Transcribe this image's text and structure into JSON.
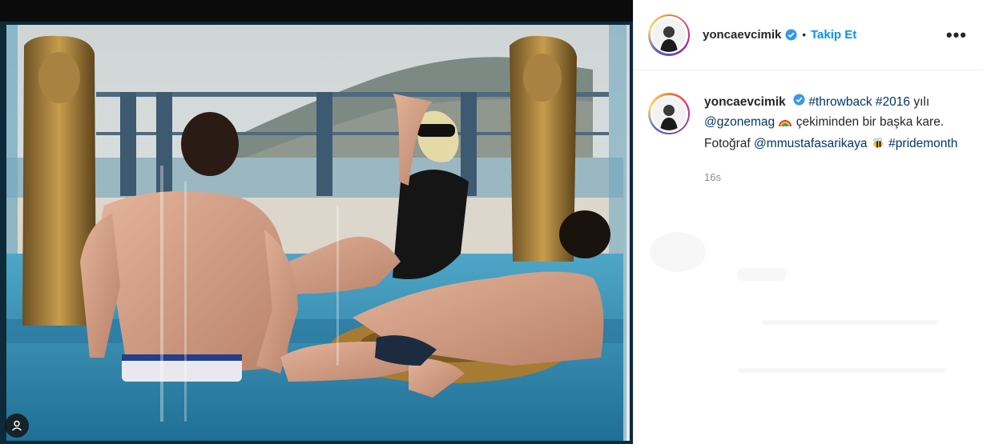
{
  "photo": {
    "alt": "pool photo",
    "icons": {
      "account_badge": "user-circle-icon"
    }
  },
  "header": {
    "username": "yoncaevcimik",
    "separator": "•",
    "follow_label": "Takip Et",
    "more_label": "•••",
    "icons": {
      "verified": "verified-badge-icon",
      "more": "more-options-icon"
    }
  },
  "caption": {
    "username": "yoncaevcimik",
    "hashtag_throwback": "#throwback",
    "hashtag_year": "#2016",
    "text_1": "yılı",
    "mention_magazine": "@gzonemag",
    "text_2": "çekiminden bir başka kare. Fotoğraf",
    "mention_photographer": "@mmustafasarikaya",
    "hashtag_pride": "#pridemonth",
    "time": "16s"
  },
  "colors": {
    "link": "#0095f6",
    "tag": "#00376b",
    "muted": "#8e8e8e",
    "verified": "#3897f0"
  }
}
